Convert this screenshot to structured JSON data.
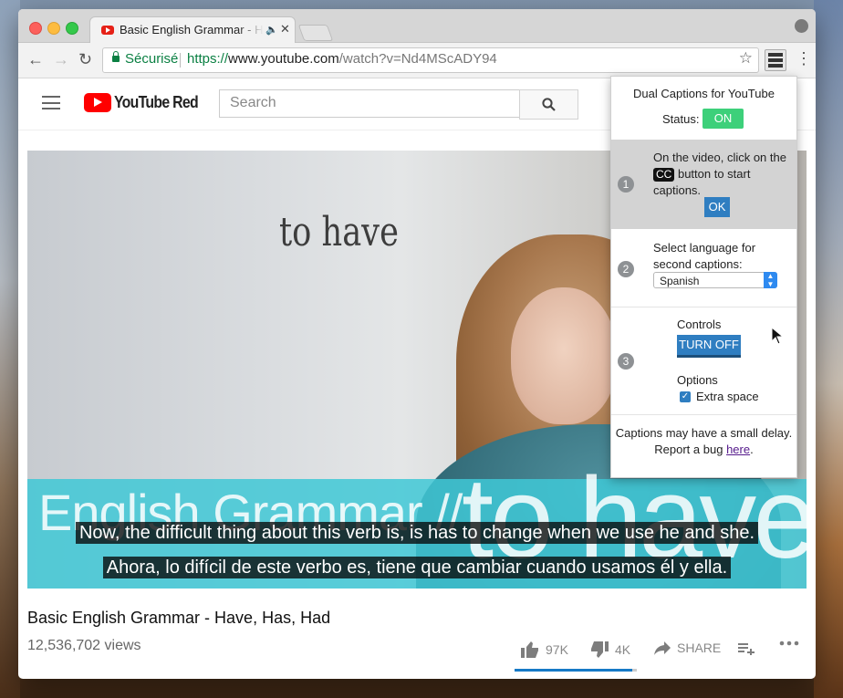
{
  "browser": {
    "tab_title": "Basic English Grammar - Have, Has, Had",
    "tab_audio_icon": "speaker-icon",
    "security_label": "Sécurisé",
    "url_protocol": "https://",
    "url_host": "www.youtube.com",
    "url_path": "/watch?v=Nd4MScADY94"
  },
  "youtube": {
    "logo_text": "YouTube Red",
    "search_placeholder": "Search",
    "video": {
      "board_text": "to have",
      "banner_text": "English Grammar //",
      "banner_big_text": "to have",
      "caption_en": "Now, the difficult thing about this verb is, is has to change when we use he and she.",
      "caption_es": "Ahora, lo difícil de este verbo es, tiene que cambiar cuando usamos él y ella."
    },
    "title": "Basic English Grammar - Have, Has, Had",
    "views": "12,536,702 views",
    "actions": {
      "likes": "97K",
      "dislikes": "4K",
      "share": "SHARE",
      "like_ratio": 0.96
    }
  },
  "extension_popup": {
    "title": "Dual Captions for YouTube",
    "status_label": "Status:",
    "status_value": "ON",
    "step1": {
      "number": "1",
      "text_before": "On the video, click on the",
      "cc_label": "CC",
      "text_after": "button to start captions.",
      "ok_label": "OK"
    },
    "step2": {
      "number": "2",
      "text": "Select language for second captions:",
      "selected_language": "Spanish"
    },
    "step3": {
      "number": "3",
      "controls_label": "Controls",
      "turn_off_label": "TURN OFF",
      "options_label": "Options",
      "extra_space_label": "Extra space",
      "extra_space_checked": true
    },
    "footer_text": "Captions may have a small delay.",
    "report_prefix": "Report a bug",
    "report_link": "here",
    "report_suffix": "."
  },
  "colors": {
    "youtube_red": "#ff0000",
    "status_on": "#3dd07a",
    "button_blue": "#2f7ec1",
    "secure_green": "#0b8043",
    "banner_teal": "#40c8d6"
  }
}
